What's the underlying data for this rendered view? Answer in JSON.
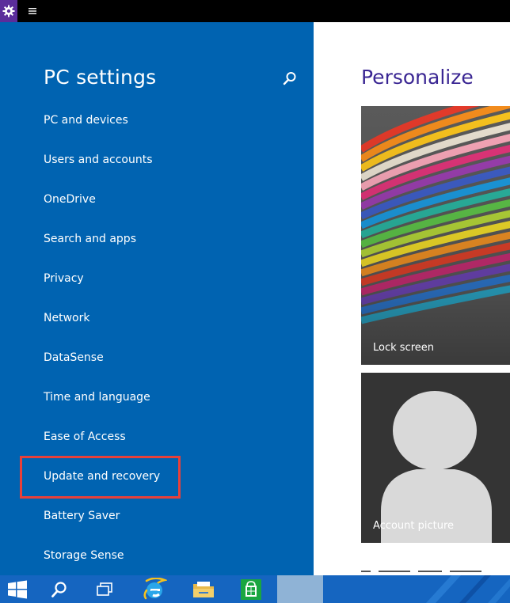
{
  "left_pane": {
    "title": "PC settings",
    "items": [
      {
        "label": "PC and devices"
      },
      {
        "label": "Users and accounts"
      },
      {
        "label": "OneDrive"
      },
      {
        "label": "Search and apps"
      },
      {
        "label": "Privacy"
      },
      {
        "label": "Network"
      },
      {
        "label": "DataSense"
      },
      {
        "label": "Time and language"
      },
      {
        "label": "Ease of Access"
      },
      {
        "label": "Update and recovery"
      },
      {
        "label": "Battery Saver"
      },
      {
        "label": "Storage Sense"
      }
    ]
  },
  "right_pane": {
    "title": "Personalize",
    "lock_screen_label": "Lock screen",
    "account_picture_label": "Account picture"
  },
  "icons": {
    "app": "gear-icon",
    "menu": "hamburger-menu-icon",
    "search": "search-icon",
    "taskbar": [
      "windows-logo-icon",
      "search-icon",
      "task-view-icon",
      "internet-explorer-icon",
      "file-explorer-icon",
      "store-icon"
    ]
  },
  "colors": {
    "pane_background": "#0063b1",
    "title_accent": "#3a2693",
    "app_icon_background": "#5b2d9b",
    "highlight": "#e8403a",
    "taskbar": "#1565c0"
  }
}
